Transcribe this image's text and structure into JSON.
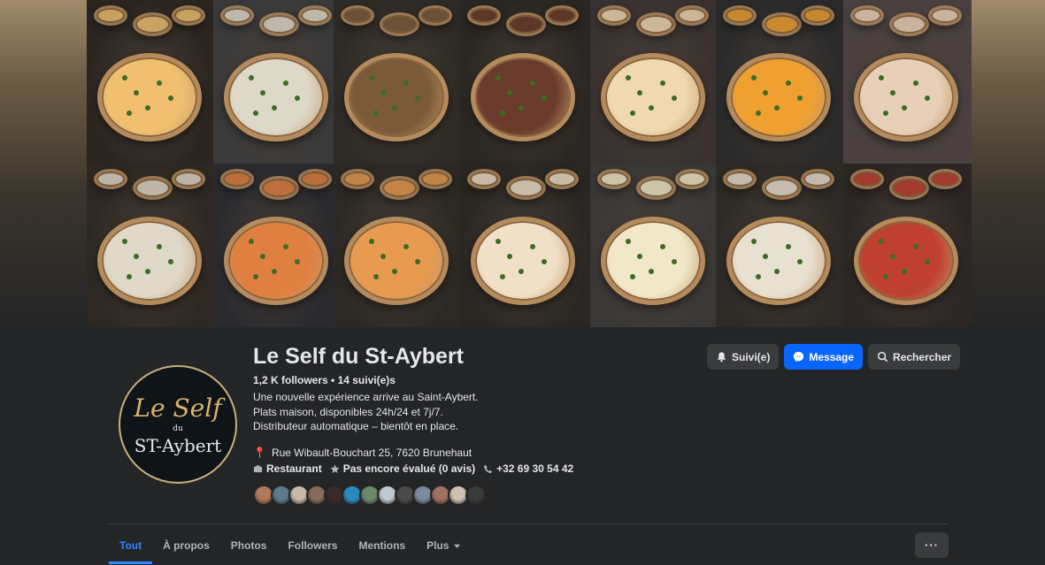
{
  "page": {
    "name": "Le Self du St-Aybert",
    "followers": "1,2 K followers",
    "following": "14 suivi(e)s",
    "separator": " • ",
    "bio": [
      "Une nouvelle expérience arrive au Saint-Aybert.",
      "Plats maison, disponibles 24h/24 et 7j/7.",
      "Distributeur automatique – bientôt en place."
    ],
    "address": "Rue Wibault-Bouchart 25, 7620 Brunehaut",
    "category": "Restaurant",
    "rating": "Pas encore évalué (0 avis)",
    "phone": "+32 69 30 54 42"
  },
  "logo": {
    "line1": "Le Self",
    "line2": "du",
    "line3": "ST-Aybert"
  },
  "actions": {
    "following_label": "Suivi(e)",
    "message_label": "Message",
    "search_label": "Rechercher"
  },
  "tabs": [
    {
      "label": "Tout",
      "active": true
    },
    {
      "label": "À propos"
    },
    {
      "label": "Photos"
    },
    {
      "label": "Followers"
    },
    {
      "label": "Mentions"
    },
    {
      "label": "Plus"
    }
  ],
  "more_menu": "···",
  "friend_avatar_colors": [
    "#b07a5a",
    "#5d7b8a",
    "#c9b8a8",
    "#8a6a5a",
    "#3a2a2a",
    "#2a8ac0",
    "#6a8a6a",
    "#c0c8d0",
    "#4a4a4a",
    "#7a8aa0",
    "#a07060",
    "#d0c0b0",
    "#3a3a3a"
  ],
  "colors": {
    "accent": "#0866ff",
    "tab_active": "#2d88ff",
    "background": "#242526"
  }
}
